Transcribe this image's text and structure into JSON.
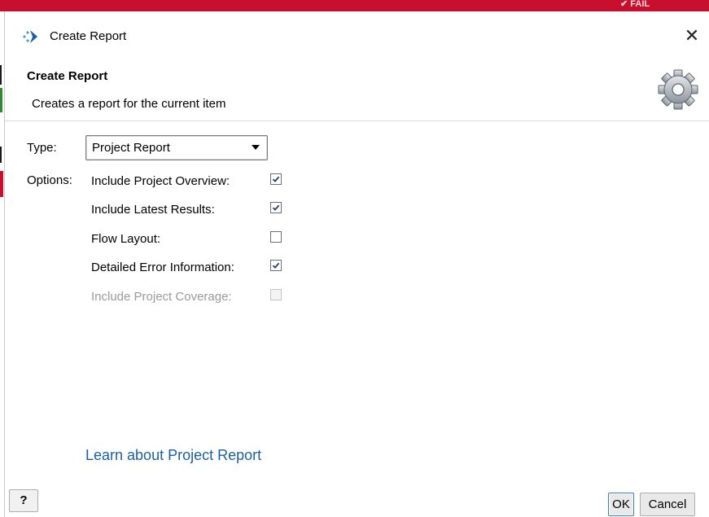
{
  "background": {
    "status_text": "✔ FAIL",
    "accent": "#c8102e"
  },
  "window": {
    "title": "Create Report",
    "close_glyph": "✕",
    "app_icon": "app-logo-icon"
  },
  "header": {
    "title": "Create Report",
    "subtitle": "Creates a report for the current item",
    "icon": "gear-icon"
  },
  "form": {
    "type_label": "Type:",
    "type_value": "Project Report",
    "options_label": "Options:",
    "options": [
      {
        "label": "Include Project Overview:",
        "checked": true,
        "enabled": true
      },
      {
        "label": "Include Latest Results:",
        "checked": true,
        "enabled": true
      },
      {
        "label": "Flow Layout:",
        "checked": false,
        "enabled": true
      },
      {
        "label": "Detailed Error Information:",
        "checked": true,
        "enabled": true
      },
      {
        "label": "Include Project Coverage:",
        "checked": false,
        "enabled": false
      }
    ]
  },
  "learn_link": "Learn about Project Report",
  "footer": {
    "help_label": "?",
    "ok_label": "OK",
    "cancel_label": "Cancel"
  },
  "colors": {
    "link": "#1c5fa8",
    "check": "#1f3f78",
    "disabled_text": "#9a9a9a"
  }
}
